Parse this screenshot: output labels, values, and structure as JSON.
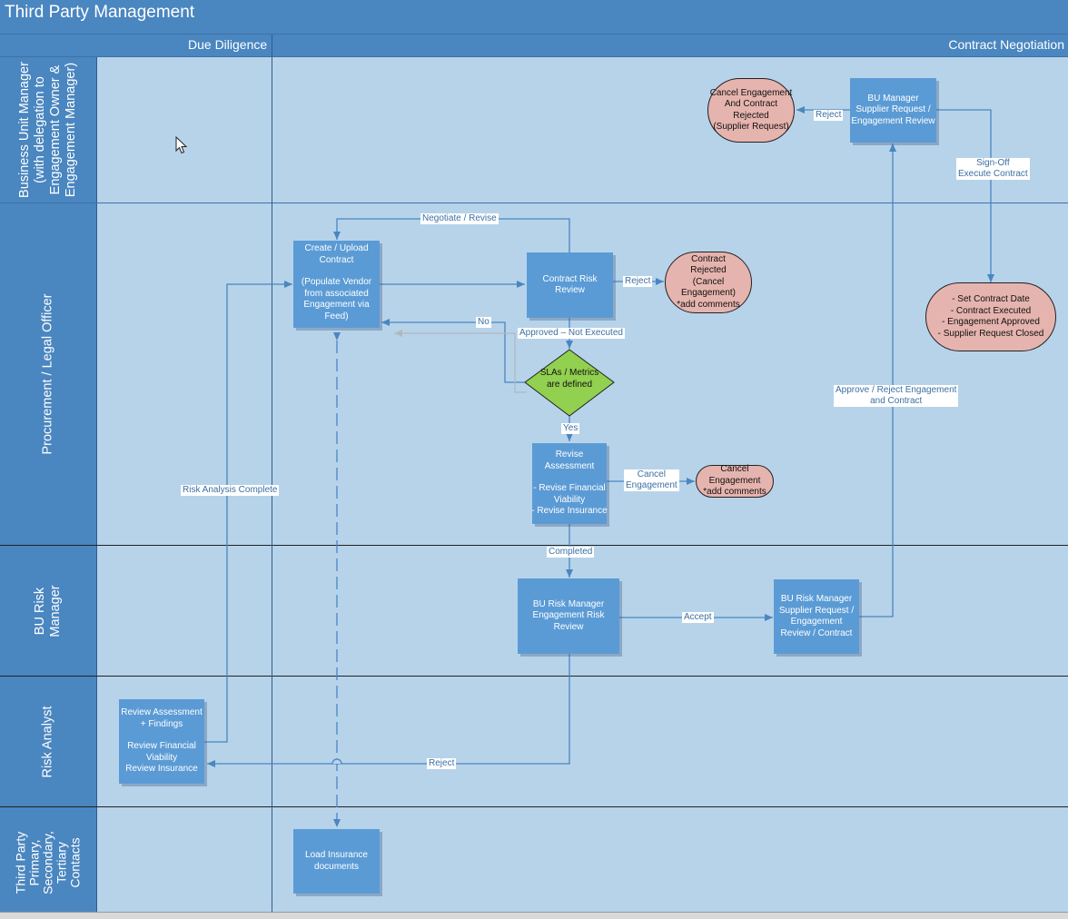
{
  "title": "Third Party Management",
  "phases": [
    "Due Diligence",
    "Contract Negotiation"
  ],
  "lanes": [
    {
      "lines": [
        "Business Unit Manager",
        "(with delegation to",
        "Engagement Owner &",
        "Engagement Manager)"
      ]
    },
    {
      "lines": [
        "Procurement / Legal Officer"
      ]
    },
    {
      "lines": [
        "BU Risk",
        "Manager"
      ]
    },
    {
      "lines": [
        "Risk Analyst"
      ]
    },
    {
      "lines": [
        "Third Party",
        "Primary,",
        "Secondary,",
        "Tertiary",
        "Contacts"
      ]
    }
  ],
  "shapes": {
    "bu_manager_review": [
      "BU Manager",
      "Supplier Request /",
      "Engagement Review"
    ],
    "cancel_engagement_rejected": [
      "Cancel Engagement",
      "And Contract",
      "Rejected",
      "(Supplier Request)"
    ],
    "create_upload_contract": [
      "Create / Upload",
      "Contract",
      "",
      "(Populate Vendor",
      "from associated",
      "Engagement via",
      "Feed)"
    ],
    "contract_risk_review": [
      "Contract Risk",
      "Review"
    ],
    "contract_rejected": [
      "Contract",
      "Rejected",
      "(Cancel",
      "Engagement)",
      "*add comments"
    ],
    "slas_defined": [
      "SLAs / Metrics",
      "are defined"
    ],
    "revise_assessment": [
      "Revise",
      "Assessment",
      "",
      "- Revise Financial",
      "Viability",
      "- Revise Insurance"
    ],
    "cancel_engagement": [
      "Cancel",
      "Engagement",
      "*add comments"
    ],
    "set_contract_date": [
      "- Set Contract Date",
      "- Contract Executed",
      "- Engagement Approved",
      "- Supplier Request Closed"
    ],
    "bu_risk_manager_review": [
      "BU Risk Manager",
      "Engagement Risk",
      "Review"
    ],
    "bu_risk_manager_contract": [
      "BU Risk Manager",
      "Supplier Request /",
      "Engagement",
      "Review / Contract"
    ],
    "review_assessment": [
      "Review Assessment",
      "+ Findings",
      "",
      "Review Financial",
      "Viability",
      "Review Insurance"
    ],
    "load_insurance": [
      "Load Insurance",
      "documents"
    ]
  },
  "edge_labels": {
    "reject_top": "Reject",
    "sign_off": [
      "Sign-Off",
      "Execute Contract"
    ],
    "negotiate_revise": "Negotiate / Revise",
    "reject_contract": "Reject",
    "no": "No",
    "approved_not_executed": "Approved – Not Executed",
    "yes": "Yes",
    "cancel": [
      "Cancel",
      "Engagement"
    ],
    "approve_reject": [
      "Approve / Reject Engagement",
      "and Contract"
    ],
    "risk_analysis_complete": "Risk Analysis Complete",
    "completed": "Completed",
    "accept": "Accept",
    "reject_bottom": "Reject"
  },
  "colors": {
    "header": "#4a86c0",
    "lane_bg": "#b7d3ea",
    "process": "#5b9bd5",
    "terminator": "#e6b4ae",
    "decision": "#92d050",
    "connector": "#4a86c0"
  },
  "icons": [
    "mouse-cursor-icon"
  ]
}
